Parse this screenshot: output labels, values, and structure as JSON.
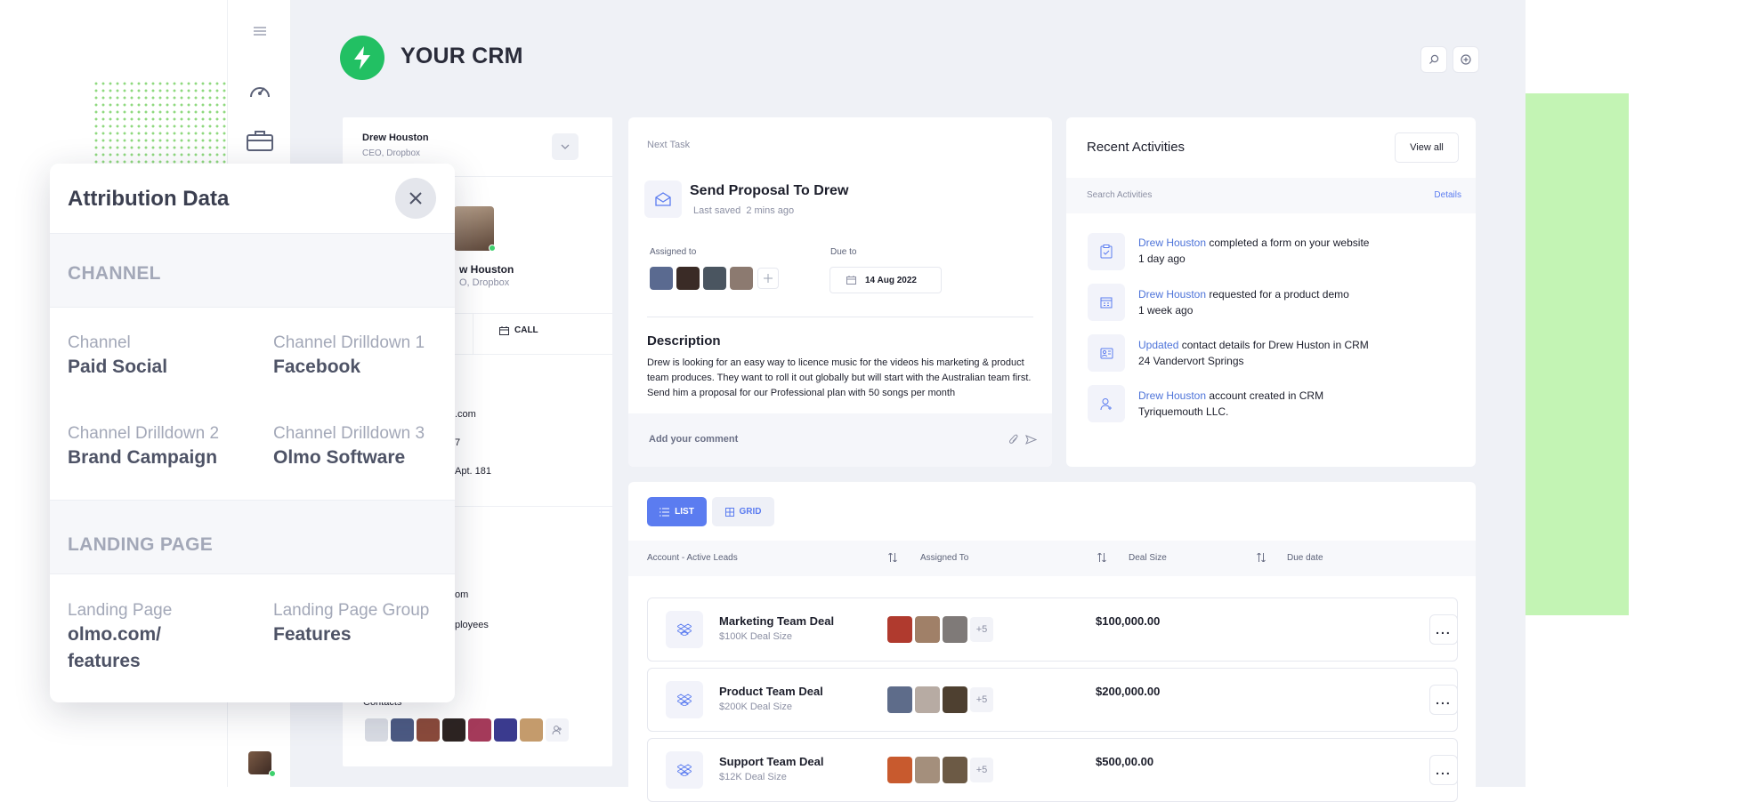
{
  "app": {
    "title": "YOUR CRM"
  },
  "contact": {
    "name": "Drew Houston",
    "role": "CEO, Dropbox",
    "partial_name": "w Houston",
    "partial_role": "O, Dropbox",
    "call_label": "CALL",
    "partial_lines": [
      ".com",
      "7",
      "Apt. 181",
      "om",
      "ployees"
    ],
    "contacts_label": "Contacts"
  },
  "task": {
    "section_label": "Next Task",
    "title": "Send Proposal To Drew",
    "last_saved": "Last saved",
    "saved_ago": "2 mins ago",
    "assigned_label": "Assigned to",
    "due_label": "Due to",
    "due_date": "14 Aug 2022",
    "description_title": "Description",
    "description": "Drew is looking for an easy way to licence music for the videos his marketing & product team produces. They want to roll it out globally but will start with the Australian team first. Send him a proposal for our Professional plan with 50 songs per month",
    "comment_placeholder": "Add your comment"
  },
  "recent": {
    "title": "Recent Activities",
    "view_all": "View all",
    "search_label": "Search Activities",
    "details_label": "Details",
    "items": [
      {
        "link": "Drew Houston",
        "text": " completed a form on your website",
        "sub": "1 day ago",
        "icon": "clipboard-icon"
      },
      {
        "link": "Drew Houston",
        "text": " requested for a product demo",
        "sub": "1 week ago",
        "icon": "calendar-icon"
      },
      {
        "link": "Updated",
        "text": " contact details for Drew Huston in CRM",
        "sub": "24 Vandervort Springs",
        "icon": "contact-card-icon"
      },
      {
        "link": "Drew Houston",
        "text": " account created in CRM",
        "sub": "Tyriquemouth LLC.",
        "icon": "user-add-icon"
      }
    ]
  },
  "deals": {
    "view_list": "LIST",
    "view_grid": "GRID",
    "columns": [
      "Account - Active Leads",
      "Assigned To",
      "Deal Size",
      "Due date"
    ],
    "rows": [
      {
        "name": "Marketing Team Deal",
        "size_label": "$100K Deal Size",
        "amount": "$100,000.00",
        "extra": "+5"
      },
      {
        "name": "Product Team Deal",
        "size_label": "$200K Deal Size",
        "amount": "$200,000.00",
        "extra": "+5"
      },
      {
        "name": "Support Team Deal",
        "size_label": "$12K Deal Size",
        "amount": "$500,00.00",
        "extra": "+5"
      }
    ]
  },
  "attribution": {
    "title": "Attribution Data",
    "channel_section": "CHANNEL",
    "landing_section": "LANDING PAGE",
    "fields": {
      "channel_label": "Channel",
      "channel_value": "Paid Social",
      "drill1_label": "Channel Drilldown 1",
      "drill1_value": "Facebook",
      "drill2_label": "Channel Drilldown 2",
      "drill2_value": "Brand Campaign",
      "drill3_label": "Channel Drilldown 3",
      "drill3_value": "Olmo Software",
      "landing_label": "Landing Page",
      "landing_value": "olmo.com/ features",
      "landing_group_label": "Landing Page Group",
      "landing_group_value": "Features"
    }
  },
  "colors": {
    "brand_green": "#22c063",
    "accent_blue": "#5b7cf0",
    "link_blue": "#4d73d9",
    "decor_green": "#c3f4b4"
  }
}
